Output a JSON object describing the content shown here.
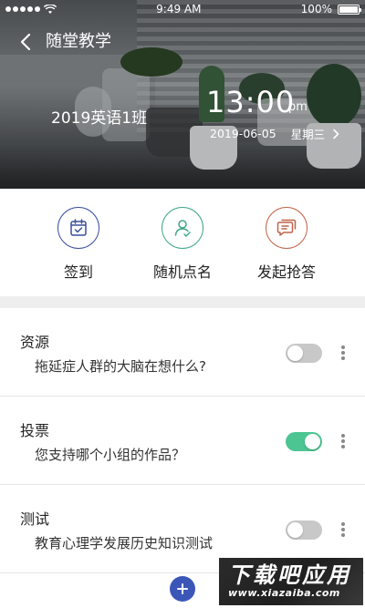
{
  "status_bar": {
    "time": "9:49 AM",
    "battery": "100%",
    "signal_icon": "signal-dots-icon",
    "wifi_icon": "wifi-icon"
  },
  "header": {
    "title": "随堂教学",
    "back_icon": "chevron-left-icon"
  },
  "class_info": {
    "class_name": "2019英语1班",
    "time": "13:00",
    "ampm": "pm",
    "date": "2019-06-05",
    "weekday": "星期三"
  },
  "actions": [
    {
      "label": "签到",
      "icon": "calendar-check-icon",
      "color": "#3b4f9a"
    },
    {
      "label": "随机点名",
      "icon": "user-random-icon",
      "color": "#3fa58a"
    },
    {
      "label": "发起抢答",
      "icon": "message-icon",
      "color": "#c0644a"
    }
  ],
  "list": [
    {
      "category": "资源",
      "subtitle": "拖延症人群的大脑在想什么?",
      "enabled": false
    },
    {
      "category": "投票",
      "subtitle": "您支持哪个小组的作品？",
      "enabled": true
    },
    {
      "category": "测试",
      "subtitle": "教育心理学发展历史知识测试",
      "enabled": false
    }
  ],
  "fab": {
    "icon": "plus-icon",
    "color": "#3c56b8"
  },
  "watermark": {
    "main": "下载吧应用",
    "sub": "www.xiazaiba.com"
  },
  "colors": {
    "toggle_on": "#4cc592",
    "toggle_off": "#c8c8c8"
  }
}
